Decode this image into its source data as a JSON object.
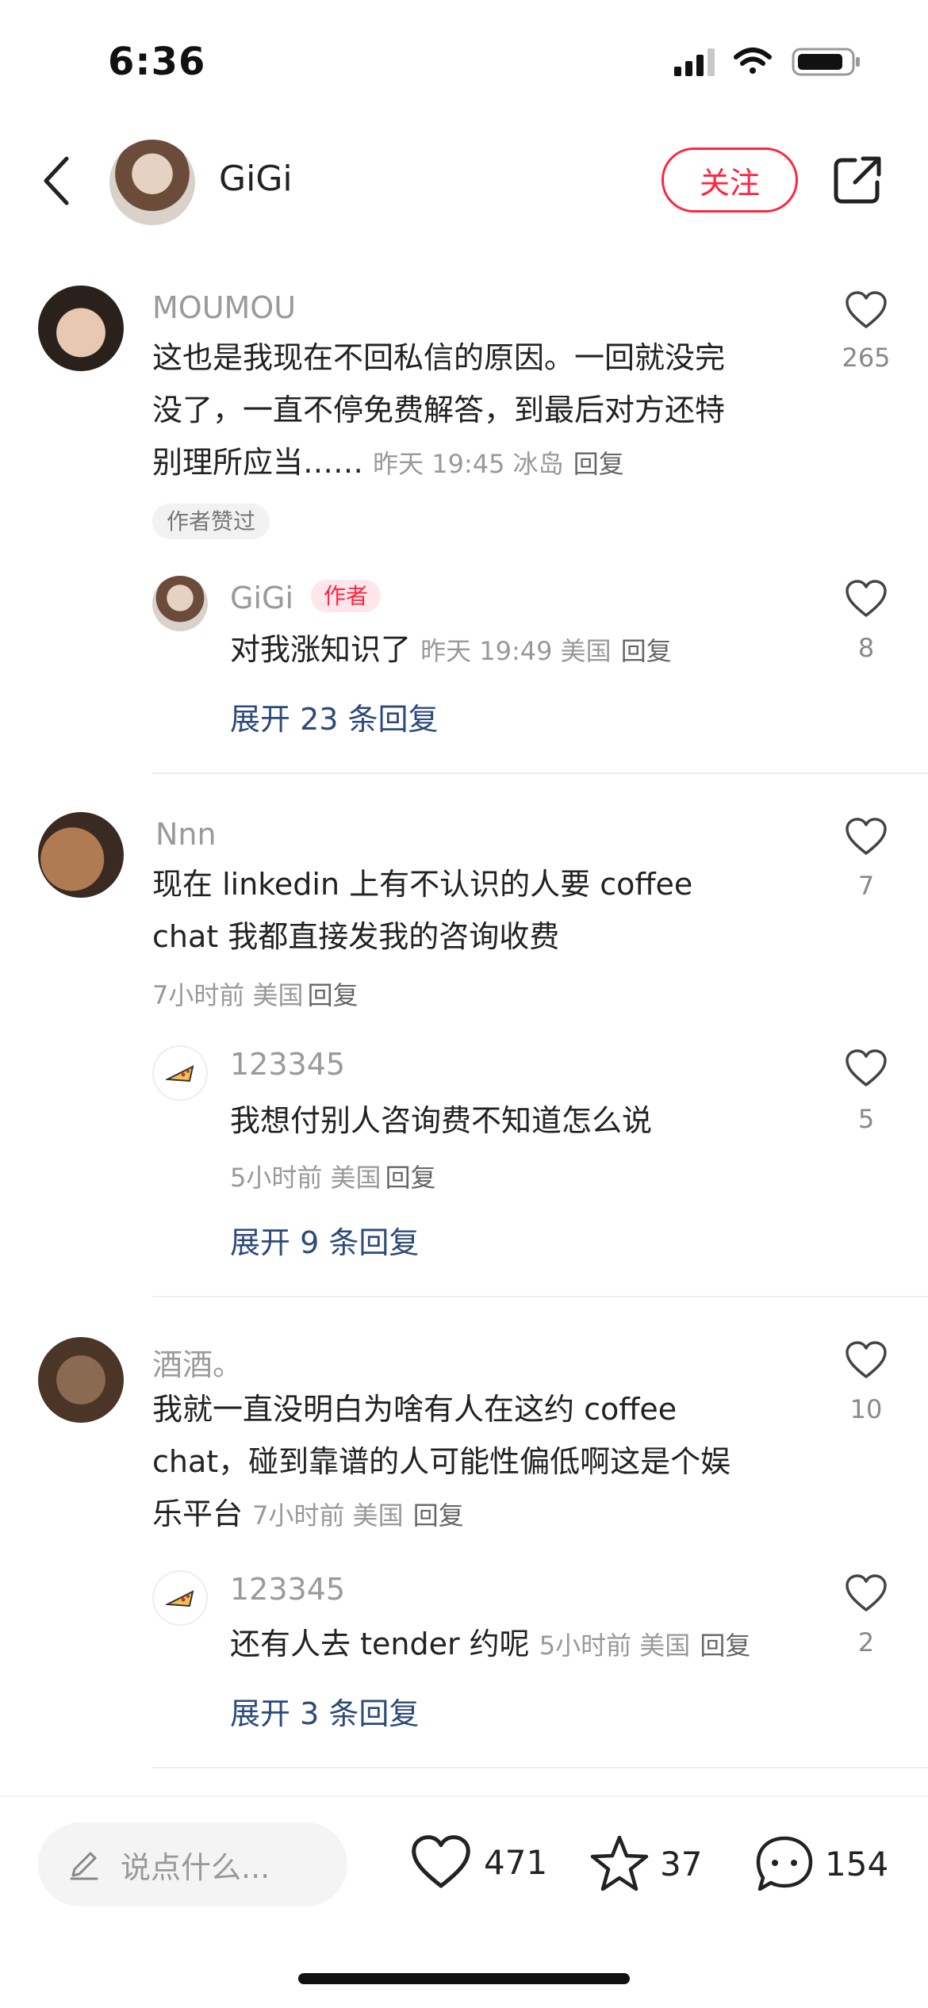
{
  "status_bar": {
    "time": "6:36"
  },
  "header": {
    "username": "GiGi",
    "follow_label": "关注"
  },
  "comments": [
    {
      "user": "MOUMOU",
      "text_lines": [
        "这也是我现在不回私信的原因。一回就没完",
        "没了，一直不停免费解答，到最后对方还特",
        "别理所应当……"
      ],
      "meta": "昨天 19:45 冰岛",
      "reply_label": "回复",
      "likes": "265",
      "badge": "作者赞过",
      "reply": {
        "user": "GiGi",
        "author_tag": "作者",
        "text": "对我涨知识了",
        "meta": "昨天 19:49 美国",
        "reply_label": "回复",
        "likes": "8"
      },
      "expand_label": "展开 23 条回复"
    },
    {
      "user": "Nnn",
      "text_lines": [
        "现在 linkedin 上有不认识的人要 coffee",
        "chat 我都直接发我的咨询收费"
      ],
      "meta": "7小时前 美国",
      "reply_label": "回复",
      "likes": "7",
      "reply": {
        "user": "123345",
        "text": "我想付别人咨询费不知道怎么说",
        "meta": "5小时前 美国",
        "reply_label": "回复",
        "likes": "5"
      },
      "expand_label": "展开 9 条回复"
    },
    {
      "user": "酒酒。",
      "text_lines": [
        "我就一直没明白为啥有人在这约 coffee",
        "chat，碰到靠谱的人可能性偏低啊这是个娱",
        "乐平台"
      ],
      "meta": "7小时前 美国",
      "reply_label": "回复",
      "likes": "10",
      "reply": {
        "user": "123345",
        "text": "还有人去 tender 约呢",
        "meta": "5小时前 美国",
        "reply_label": "回复",
        "likes": "2"
      },
      "expand_label": "展开 3 条回复"
    }
  ],
  "bottom_bar": {
    "input_placeholder": "说点什么...",
    "likes": "471",
    "stars": "37",
    "comments": "154"
  },
  "colors": {
    "accent": "#ff2442",
    "link": "#2e4a7a",
    "muted": "#999999"
  }
}
